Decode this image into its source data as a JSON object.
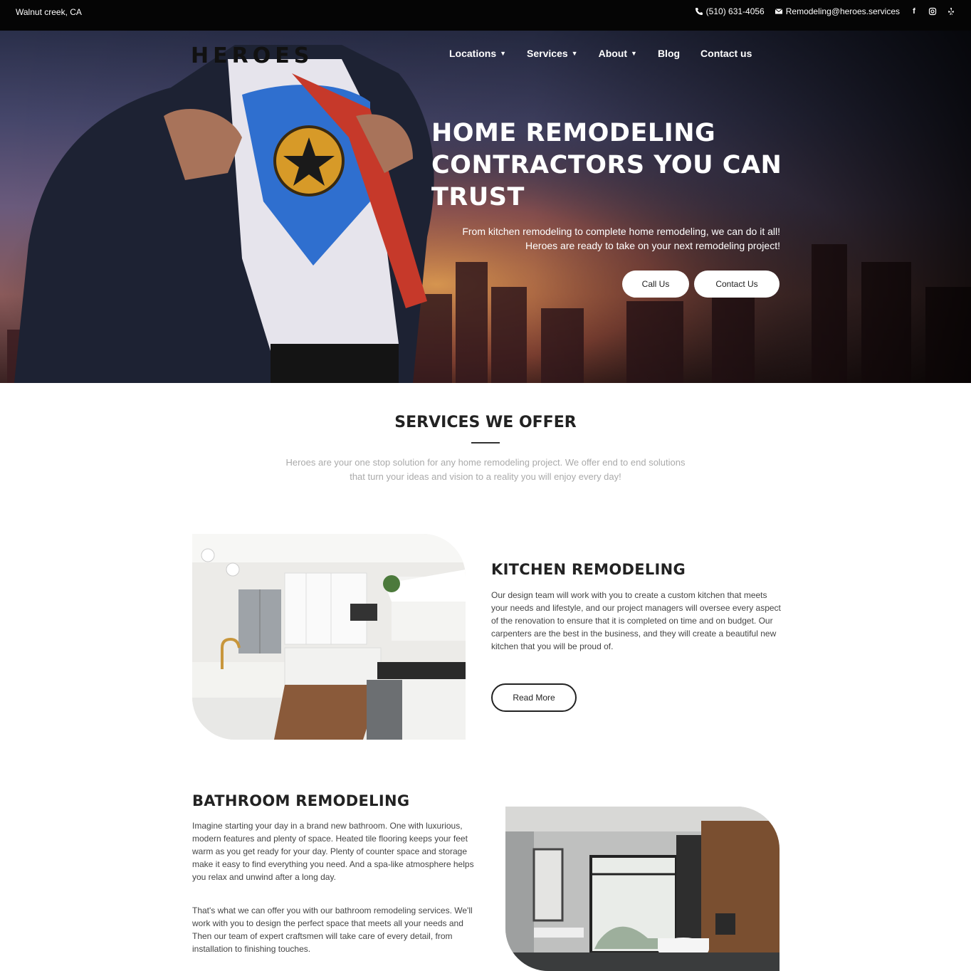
{
  "topbar": {
    "location": "Walnut creek, CA",
    "phone": "(510) 631-4056",
    "email": "Remodeling@heroes.services",
    "social_icons": [
      "facebook-icon",
      "instagram-icon",
      "yelp-icon"
    ]
  },
  "header": {
    "logo": "HEROES",
    "nav": [
      {
        "label": "Locations",
        "has_dropdown": true
      },
      {
        "label": "Services",
        "has_dropdown": true
      },
      {
        "label": "About",
        "has_dropdown": true
      },
      {
        "label": "Blog",
        "has_dropdown": false
      },
      {
        "label": "Contact us",
        "has_dropdown": false
      }
    ]
  },
  "hero": {
    "title_line1": "HOME REMODELING",
    "title_line2": "CONTRACTORS YOU CAN",
    "title_line3": "TRUST",
    "subtitle": "From kitchen remodeling to complete home remodeling, we can do it all! Heroes are ready to take on your next remodeling project!",
    "call_button": "Call Us",
    "contact_button": "Contact Us"
  },
  "services": {
    "title": "SERVICES WE OFFER",
    "description": "Heroes are your one stop solution for any home remodeling project. We offer end to end solutions that turn your ideas and vision to a reality you will enjoy every day!"
  },
  "kitchen": {
    "title": "KITCHEN REMODELING",
    "text": "Our design team will work with you to create a custom kitchen that meets your needs and lifestyle, and our project managers will oversee every aspect of the renovation to ensure that it is completed on time and on budget. Our carpenters are the best in the business, and they will create a beautiful new kitchen that you will be proud of.",
    "button": "Read More"
  },
  "bathroom": {
    "title": "BATHROOM REMODELING",
    "text1": "Imagine starting your day in a brand new bathroom. One with luxurious, modern features and plenty of space. Heated tile flooring keeps your feet warm as you get ready for your day. Plenty of counter space and storage make it easy to find everything you need. And a spa-like atmosphere helps you relax and unwind after a long day.",
    "text2": "That's what we can offer you with our bathroom remodeling services. We'll work with you to design the perfect space that meets all your needs and Then our team of expert craftsmen will take care of every detail, from installation to finishing touches."
  },
  "colors": {
    "topbar_bg": "#050505",
    "text_dark": "#222222",
    "muted_text": "#aaaaaa"
  }
}
